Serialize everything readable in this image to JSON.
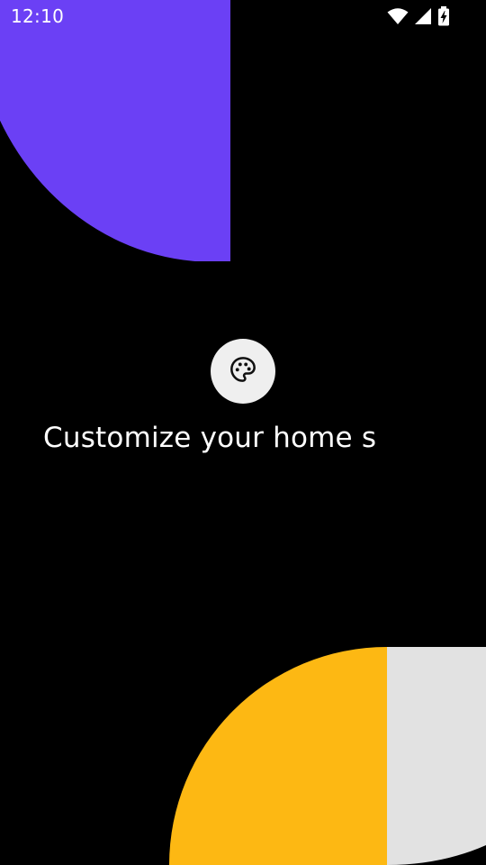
{
  "status_bar": {
    "time": "12:10",
    "icons": [
      "wifi-icon",
      "cell-signal-icon",
      "battery-charging-icon"
    ]
  },
  "onboarding": {
    "icon": "palette-icon",
    "headline": "Customize your home s"
  },
  "colors": {
    "background": "#000000",
    "purple": "#6b40f5",
    "yellow": "#fdb813",
    "light_gray": "#e2e2e2",
    "icon_circle": "#efefef",
    "text": "#ffffff"
  }
}
